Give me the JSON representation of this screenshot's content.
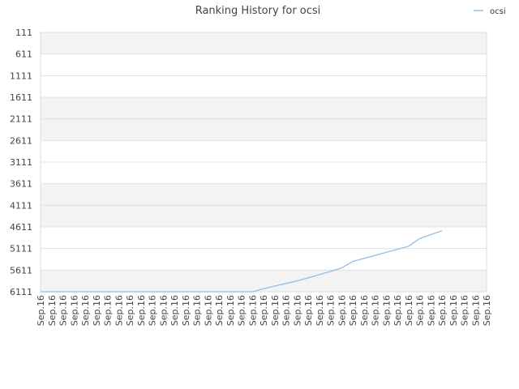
{
  "chart_data": {
    "type": "line",
    "title": "Ranking History for ocsi",
    "xlabel": "",
    "ylabel": "",
    "y_reversed": true,
    "ylim": [
      111,
      6111
    ],
    "y_ticks": [
      111,
      611,
      1111,
      1611,
      2111,
      2611,
      3111,
      3611,
      4111,
      4611,
      5111,
      5611,
      6111
    ],
    "categories": [
      "Sep.16",
      "Sep.16",
      "Sep.16",
      "Sep.16",
      "Sep.16",
      "Sep.16",
      "Sep.16",
      "Sep.16",
      "Sep.16",
      "Sep.16",
      "Sep.16",
      "Sep.16",
      "Sep.16",
      "Sep.16",
      "Sep.16",
      "Sep.16",
      "Sep.16",
      "Sep.16",
      "Sep.16",
      "Sep.16",
      "Sep.16",
      "Sep.16",
      "Sep.16",
      "Sep.16",
      "Sep.16",
      "Sep.16",
      "Sep.16",
      "Sep.16",
      "Sep.16",
      "Sep.16",
      "Sep.16",
      "Sep.16",
      "Sep.16",
      "Sep.16",
      "Sep.16",
      "Sep.16",
      "Sep.16",
      "Sep.16",
      "Sep.16",
      "Sep.16",
      "Sep.16"
    ],
    "grid": true,
    "legend_position": "top-right",
    "series": [
      {
        "name": "ocsi",
        "color": "#8fbfe8",
        "values": [
          6111,
          6111,
          6111,
          6111,
          6111,
          6111,
          6111,
          6111,
          6111,
          6111,
          6111,
          6111,
          6111,
          6111,
          6111,
          6111,
          6111,
          6111,
          6111,
          6111,
          6040,
          5980,
          5920,
          5860,
          5790,
          5715,
          5640,
          5560,
          5410,
          5340,
          5270,
          5200,
          5130,
          5060,
          4880,
          4790,
          4700
        ]
      }
    ]
  }
}
